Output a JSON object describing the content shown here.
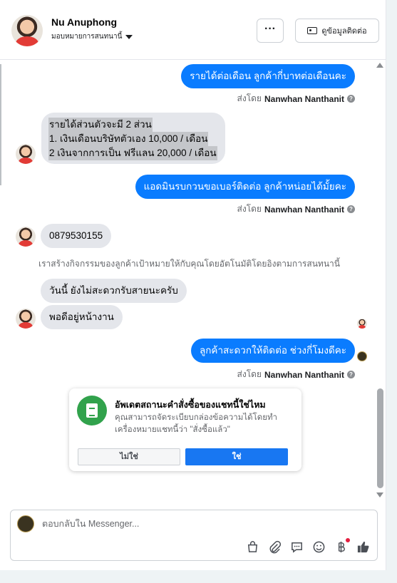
{
  "header": {
    "contact_name": "Nu Anuphong",
    "assign_label": "มอบหมายการสนทนานี้",
    "more_label": "···",
    "view_contact_label": "ดูข้อมูลติดต่อ"
  },
  "thread": {
    "messages": [
      {
        "from": "page",
        "text": "รายได้ต่อเดือน ลูกค้ากี่บาทต่อเดือนคะ"
      },
      {
        "sent_by_prefix": "ส่งโดย",
        "sent_by_name": "Nanwhan Nanthanit"
      },
      {
        "from": "customer",
        "lines": [
          "รายได้ส่วนตัวจะมี 2 ส่วน",
          "1. เงินเดือนบริษัทตัวเอง 10,000 / เดือน",
          "2 เงินจากการเป็น ฟรีแลน 20,000 / เดือน"
        ]
      },
      {
        "from": "page",
        "text": "แอดมินรบกวนขอเบอร์ติดต่อ ลูกค้าหน่อยได้มั้ยคะ"
      },
      {
        "sent_by_prefix": "ส่งโดย",
        "sent_by_name": "Nanwhan Nanthanit"
      },
      {
        "from": "customer",
        "text": "0879530155"
      },
      {
        "system": "เราสร้างกิจกรรมของลูกค้าเป้าหมายให้กับคุณโดยอัตโนมัติโดยอิงตามการสนทนานี้"
      },
      {
        "from": "customer",
        "text": "วันนี้ ยังไม่สะดวกรับสายนะครับ"
      },
      {
        "from": "customer",
        "text": "พอดีอยู่หน้างาน"
      },
      {
        "from": "page",
        "text": "ลูกค้าสะดวกให้ติดต่อ ช่วงกี่โมงดีคะ"
      },
      {
        "sent_by_prefix": "ส่งโดย",
        "sent_by_name": "Nanwhan Nanthanit"
      }
    ],
    "info_glyph": "?"
  },
  "order_prompt": {
    "title": "อัพเดตสถานะคำสั่งซื้อของแชทนี้ใช่ไหม",
    "body": "คุณสามารถจัดระเบียบกล่องข้อความได้โดยทำเครื่องหมายแชทนี้ว่า \"สั่งซื้อแล้ว\"",
    "no_label": "ไม่ใช่",
    "yes_label": "ใช่"
  },
  "composer": {
    "placeholder": "ตอบกลับใน Messenger...",
    "tools": [
      "shopping-bag-icon",
      "paperclip-icon",
      "saved-reply-icon",
      "emoji-icon",
      "baht-payment-icon",
      "like-icon"
    ]
  },
  "colors": {
    "outgoing_bubble": "#0a7cff",
    "incoming_bubble": "#e4e6eb",
    "primary_button": "#1877f2",
    "order_icon": "#31a24c"
  }
}
